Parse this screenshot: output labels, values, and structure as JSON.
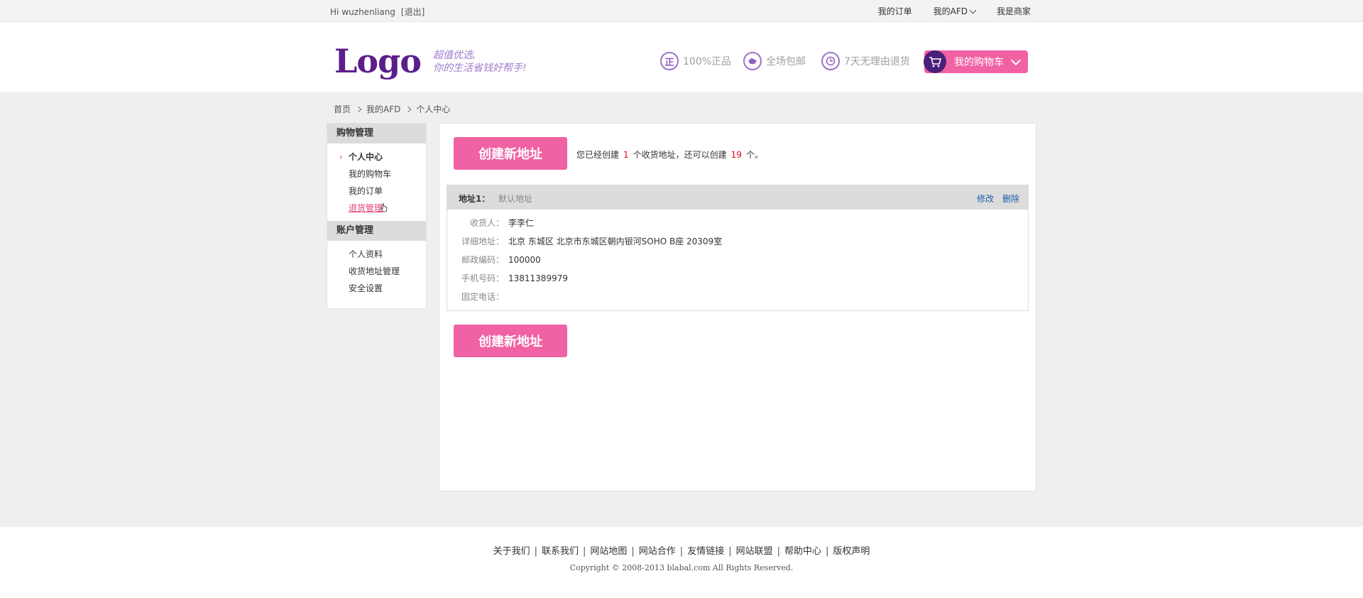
{
  "topbar": {
    "greeting": "Hi",
    "username": "wuzhenliang",
    "logout": "[退出]",
    "links": {
      "orders": "我的订单",
      "my_afd": "我的AFD",
      "merchant": "我是商家"
    }
  },
  "header": {
    "logo": "Logo",
    "slogan_line1": "超值优选,",
    "slogan_line2": "你的生活省钱好帮手!",
    "features": [
      {
        "icon": "genuine-icon",
        "text": "100%正品"
      },
      {
        "icon": "free-shipping-icon",
        "text": "全场包邮"
      },
      {
        "icon": "clock-icon",
        "text": "7天无理由退货"
      }
    ],
    "cart_label": "我的购物车"
  },
  "breadcrumb": [
    "首页",
    "我的AFD",
    "个人中心"
  ],
  "sidebar": {
    "sections": [
      {
        "title": "购物管理",
        "items": [
          "个人中心",
          "我的购物车",
          "我的订单",
          "退货管理"
        ]
      },
      {
        "title": "账户管理",
        "items": [
          "个人资料",
          "收货地址管理",
          "安全设置"
        ]
      }
    ]
  },
  "main": {
    "create_button": "创建新地址",
    "info": {
      "prefix": "您已经创建",
      "created": "1",
      "middle": "个收货地址，还可以创建",
      "remaining": "19",
      "suffix": "个。"
    },
    "address": {
      "title": "地址1：",
      "default_label": "默认地址",
      "edit": "修改",
      "delete": "删除",
      "fields": [
        {
          "label": "收货人：",
          "value": "李李仁"
        },
        {
          "label": "详细地址：",
          "value": "北京  东城区  北京市东城区朝内银河SOHO B座 20309室"
        },
        {
          "label": "邮政编码：",
          "value": "100000"
        },
        {
          "label": "手机号码：",
          "value": "13811389979"
        },
        {
          "label": "固定电话：",
          "value": ""
        }
      ]
    },
    "create_button_bottom": "创建新地址"
  },
  "footer": {
    "links": [
      "关于我们",
      "联系我们",
      "网站地图",
      "网站合作",
      "友情链接",
      "网站联盟",
      "帮助中心",
      "版权声明"
    ],
    "copyright": "Copyright © 2008-2013 blabal.com All Rights Reserved."
  },
  "colors": {
    "brand_purple": "#5b1e8b",
    "accent_pink": "#f062a3",
    "link_blue": "#1b5faa",
    "highlight_red": "#e0001a"
  }
}
